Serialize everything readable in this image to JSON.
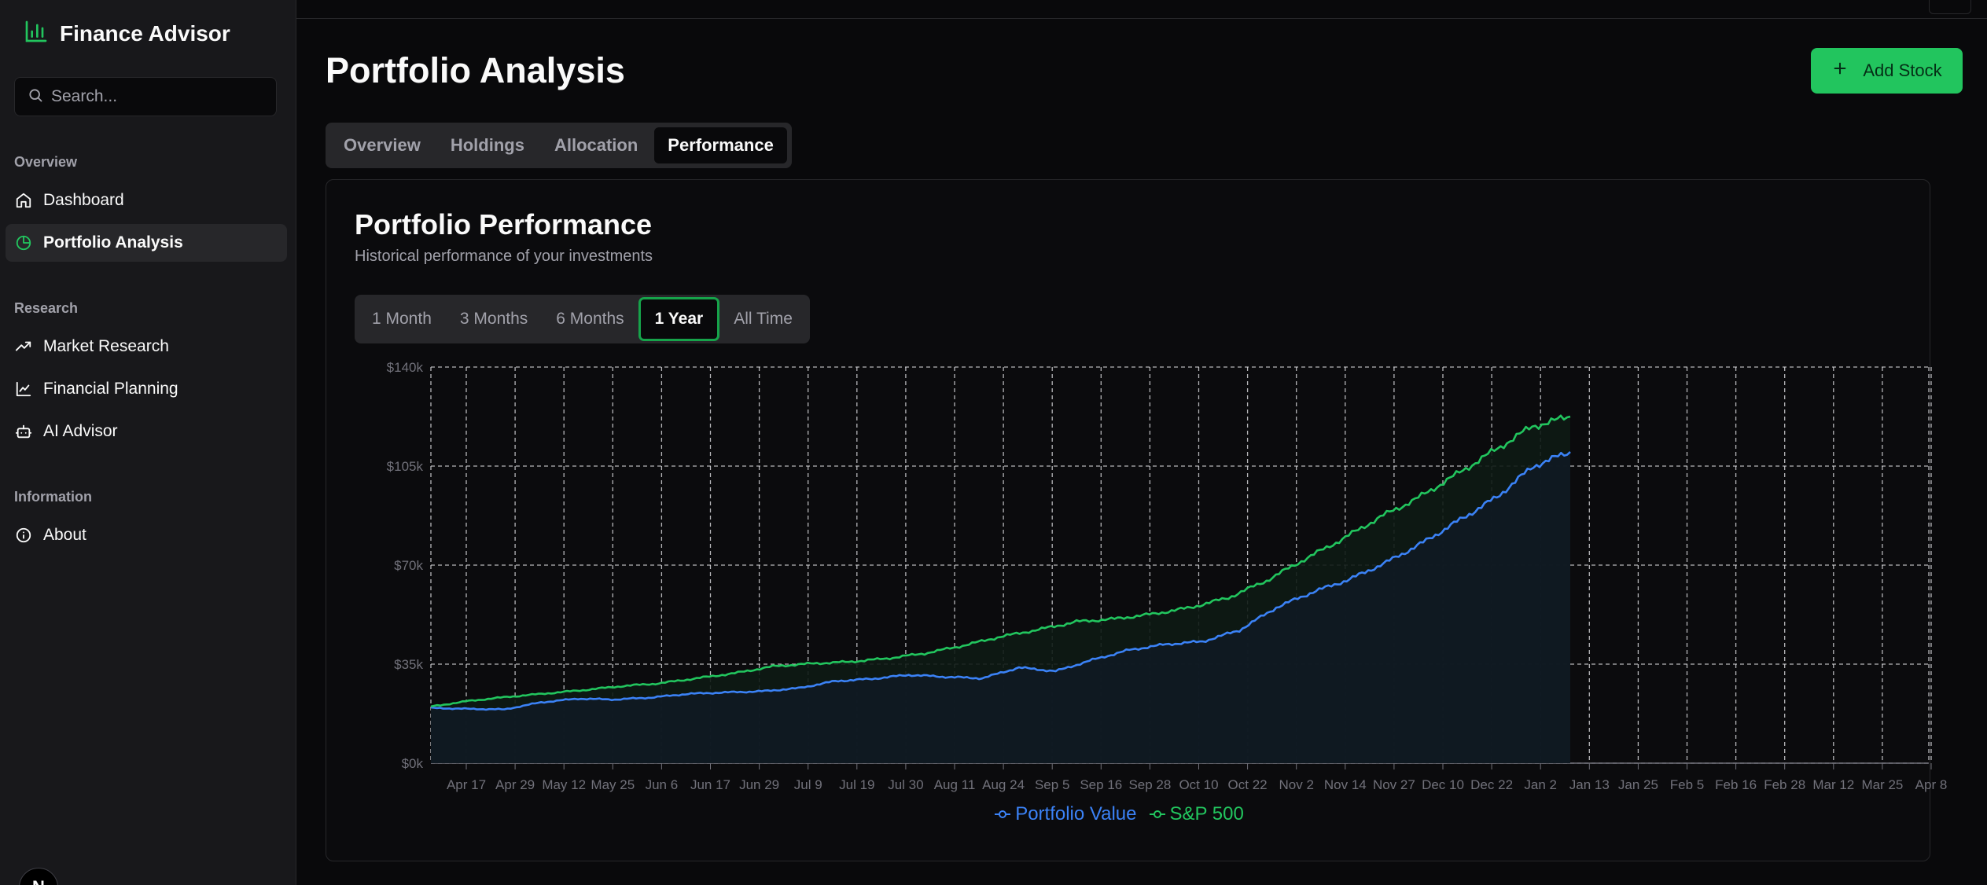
{
  "app": {
    "title": "Finance Advisor",
    "brand_color": "#22c55e"
  },
  "search": {
    "placeholder": "Search..."
  },
  "sidebar": {
    "groups": [
      {
        "label": "Overview",
        "items": [
          {
            "label": "Dashboard",
            "icon": "home-icon"
          },
          {
            "label": "Portfolio Analysis",
            "icon": "pie-chart-icon",
            "active": true
          }
        ]
      },
      {
        "label": "Research",
        "items": [
          {
            "label": "Market Research",
            "icon": "trending-up-icon"
          },
          {
            "label": "Financial Planning",
            "icon": "line-chart-icon"
          },
          {
            "label": "AI Advisor",
            "icon": "bot-icon"
          }
        ]
      },
      {
        "label": "Information",
        "items": [
          {
            "label": "About",
            "icon": "info-icon"
          }
        ]
      }
    ]
  },
  "avatar": {
    "initial": "N"
  },
  "page": {
    "title": "Portfolio Analysis",
    "add_label": "Add Stock"
  },
  "tabs": [
    {
      "label": "Overview"
    },
    {
      "label": "Holdings"
    },
    {
      "label": "Allocation"
    },
    {
      "label": "Performance",
      "active": true
    }
  ],
  "card": {
    "title": "Portfolio Performance",
    "subtitle": "Historical performance of your investments",
    "ranges": [
      {
        "label": "1 Month"
      },
      {
        "label": "3 Months"
      },
      {
        "label": "6 Months"
      },
      {
        "label": "1 Year",
        "active": true
      },
      {
        "label": "All Time"
      }
    ]
  },
  "chart_data": {
    "type": "line",
    "title": "",
    "xlabel": "",
    "ylabel": "",
    "ylim": [
      0,
      140000
    ],
    "yticks": [
      "$0k",
      "$35k",
      "$70k",
      "$105k",
      "$140k"
    ],
    "yvalues": [
      0,
      35000,
      70000,
      105000,
      140000
    ],
    "xticks": [
      "Apr 17",
      "Apr 29",
      "May 12",
      "May 25",
      "Jun 6",
      "Jun 17",
      "Jun 29",
      "Jul 9",
      "Jul 19",
      "Jul 30",
      "Aug 11",
      "Aug 24",
      "Sep 5",
      "Sep 16",
      "Sep 28",
      "Oct 10",
      "Oct 22",
      "Nov 2",
      "Nov 14",
      "Nov 27",
      "Dec 10",
      "Dec 22",
      "Jan 2",
      "Jan 13",
      "Jan 25",
      "Feb 5",
      "Feb 16",
      "Feb 28",
      "Mar 12",
      "Mar 25",
      "Apr 8"
    ],
    "grid": true,
    "legend_position": "bottom",
    "series": [
      {
        "name": "Portfolio Value",
        "color": "#3b82f6",
        "values": [
          19500,
          19200,
          19000,
          21500,
          22800,
          22500,
          23200,
          24500,
          25000,
          25400,
          26500,
          29000,
          29800,
          31200,
          30500,
          30000,
          33800,
          32500,
          36500,
          40000,
          42000,
          43000,
          47000,
          55000,
          60500,
          65000,
          71000,
          78000,
          86000,
          94000,
          105000,
          110000
        ]
      },
      {
        "name": "S&P 500",
        "color": "#22c55e",
        "values": [
          20000,
          22000,
          23400,
          24600,
          25800,
          27200,
          28200,
          30000,
          31800,
          34200,
          35200,
          35800,
          37000,
          38800,
          41500,
          44700,
          47200,
          50000,
          51000,
          52700,
          55000,
          58500,
          64500,
          72000,
          79200,
          87000,
          93800,
          102000,
          110500,
          119000,
          122500
        ]
      }
    ]
  }
}
